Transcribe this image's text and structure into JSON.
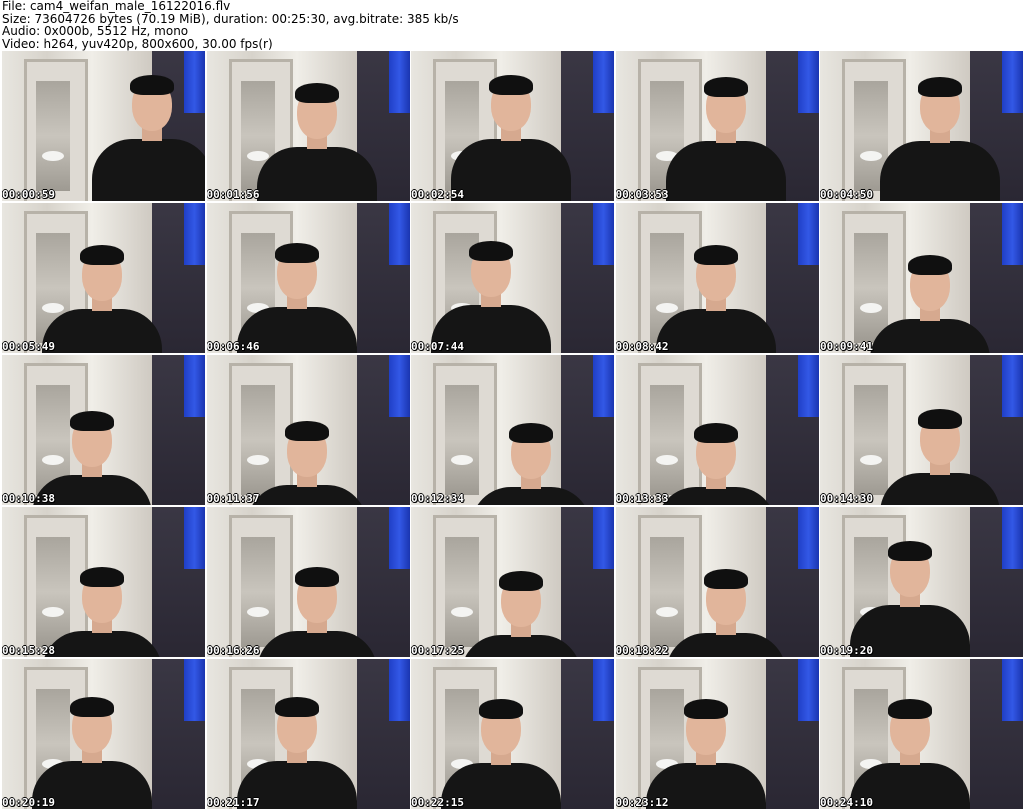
{
  "header": {
    "file_line": "File: cam4_weifan_male_16122016.flv",
    "size_line": "Size: 73604726 bytes (70.19 MiB), duration: 00:25:30, avg.bitrate: 385 kb/s",
    "audio_line": "Audio: 0x000b, 5512 Hz, mono",
    "video_line": "Video: h264, yuv420p, 800x600, 30.00 fps(r)"
  },
  "thumbnails": [
    {
      "timestamp": "00:00:59"
    },
    {
      "timestamp": "00:01:56"
    },
    {
      "timestamp": "00:02:54"
    },
    {
      "timestamp": "00:03:53"
    },
    {
      "timestamp": "00:04:50"
    },
    {
      "timestamp": "00:05:49"
    },
    {
      "timestamp": "00:06:46"
    },
    {
      "timestamp": "00:07:44"
    },
    {
      "timestamp": "00:08:42"
    },
    {
      "timestamp": "00:09:41"
    },
    {
      "timestamp": "00:10:38"
    },
    {
      "timestamp": "00:11:37"
    },
    {
      "timestamp": "00:12:34"
    },
    {
      "timestamp": "00:13:33"
    },
    {
      "timestamp": "00:14:30"
    },
    {
      "timestamp": "00:15:28"
    },
    {
      "timestamp": "00:16:26"
    },
    {
      "timestamp": "00:17:25"
    },
    {
      "timestamp": "00:18:22"
    },
    {
      "timestamp": "00:19:20"
    },
    {
      "timestamp": "00:20:19"
    },
    {
      "timestamp": "00:21:17"
    },
    {
      "timestamp": "00:22:15"
    },
    {
      "timestamp": "00:23:12"
    },
    {
      "timestamp": "00:24:10"
    }
  ],
  "colors": {
    "background": "#ffffff",
    "curtain": "#2a4ad8",
    "shirt": "#151515",
    "timestamp_text": "#ffffff"
  }
}
